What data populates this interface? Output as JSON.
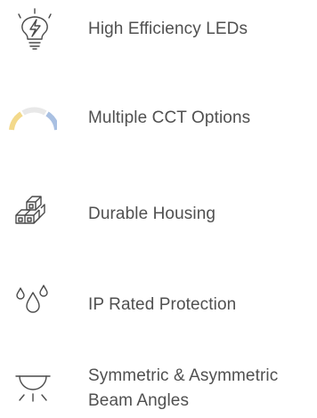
{
  "features": [
    {
      "icon": "lightbulb-bolt-icon",
      "label": "High Efficiency LEDs"
    },
    {
      "icon": "color-temperature-arc-icon",
      "label": "Multiple CCT Options"
    },
    {
      "icon": "stacked-boxes-icon",
      "label": "Durable Housing"
    },
    {
      "icon": "water-drops-icon",
      "label": "IP Rated Protection"
    },
    {
      "icon": "beam-light-icon",
      "label_line1": "Symmetric & Asymmetric",
      "label_line2": "Beam Angles"
    }
  ],
  "colors": {
    "text": "#505050",
    "icon_stroke": "#4a4a4a",
    "cct_warm": "#f3d98b",
    "cct_neutral": "#e8e8e8",
    "cct_cool": "#a9c0e2"
  }
}
